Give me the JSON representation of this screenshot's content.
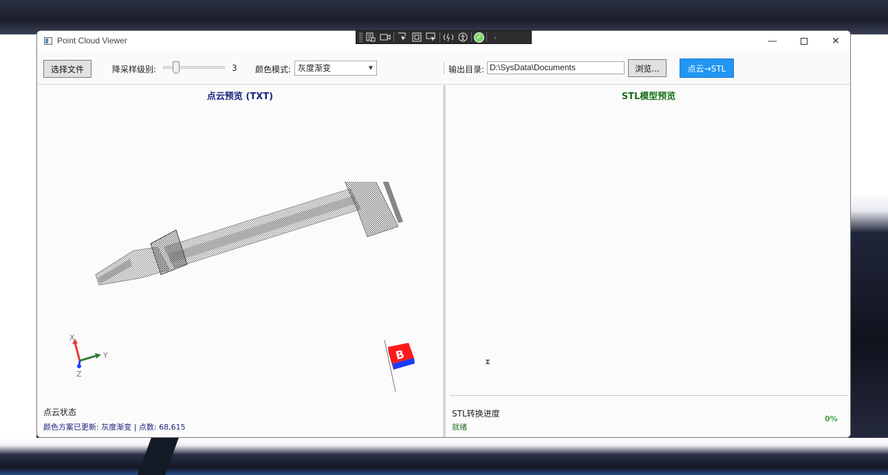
{
  "window": {
    "title": "Point Cloud Viewer"
  },
  "debug_toolbar": {
    "icons": [
      "live-tree-icon",
      "camera-icon",
      "select-element-icon",
      "display-adorner-icon",
      "track-focus-icon",
      "hot-reload-icon",
      "accessibility-icon",
      "binding-check-icon",
      "collapse-icon"
    ]
  },
  "toolbar": {
    "select_file_label": "选择文件",
    "downsample_label": "降采样级别:",
    "downsample_value": "3",
    "downsample_level": 3,
    "color_scheme_label": "颜色模式:",
    "color_scheme_value": "灰度渐变",
    "output_dir_label": "输出目录:",
    "output_dir_value": "D:\\SysData\\Documents",
    "browse_label": "浏览...",
    "convert_label": "点云→STL",
    "convert_color": "#2196f3"
  },
  "left_panel": {
    "title": "点云预览 (TXT)",
    "axis_x": "X",
    "axis_y": "Y",
    "axis_z": "Z",
    "cube_label": "B",
    "status_title": "点云状态",
    "status_line": "颜色方案已更新: 灰度渐变 | 点数: 68,615",
    "title_color": "#1a237e"
  },
  "right_panel": {
    "title": "STL模型预览",
    "status_title": "STL转换进度",
    "status_line": "就绪",
    "progress_text": "0%",
    "title_color": "#1b6e1b"
  }
}
